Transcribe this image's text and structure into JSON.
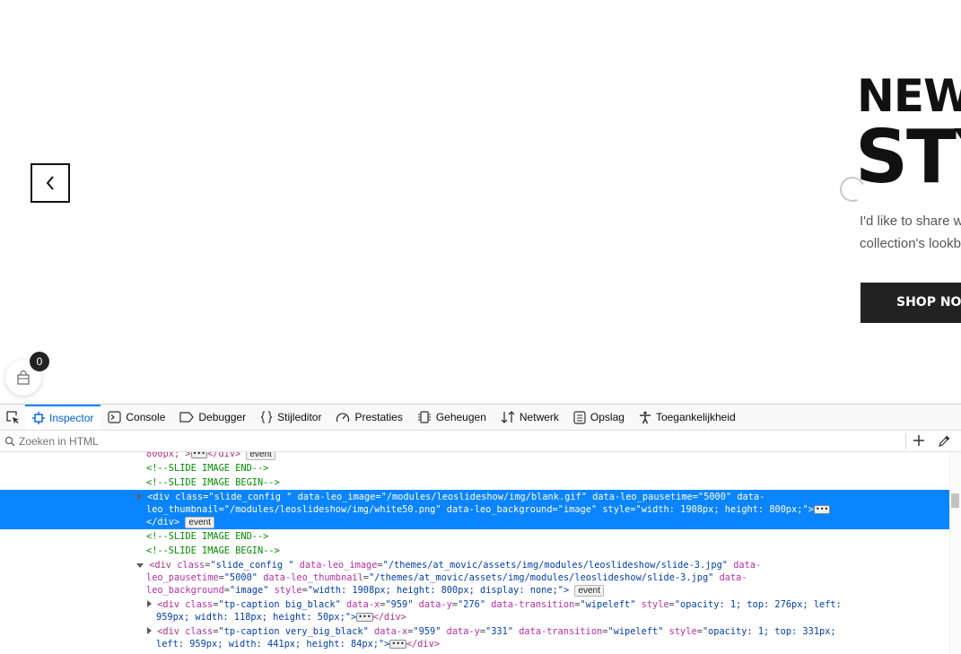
{
  "page": {
    "hero": {
      "line1": "NEW",
      "line2": "STY",
      "desc_line1": "I'd like to share w",
      "desc_line2": "collection's lookb",
      "button_label": "SHOP NOW"
    },
    "cart": {
      "count": "0"
    }
  },
  "devtools": {
    "tabs": [
      {
        "label": "Inspector",
        "icon": "inspector-icon"
      },
      {
        "label": "Console",
        "icon": "console-icon"
      },
      {
        "label": "Debugger",
        "icon": "debugger-icon"
      },
      {
        "label": "Stijleditor",
        "icon": "style-editor-icon"
      },
      {
        "label": "Prestaties",
        "icon": "performance-icon"
      },
      {
        "label": "Geheugen",
        "icon": "memory-icon"
      },
      {
        "label": "Netwerk",
        "icon": "network-icon"
      },
      {
        "label": "Opslag",
        "icon": "storage-icon"
      },
      {
        "label": "Toegankelijkheid",
        "icon": "accessibility-icon"
      }
    ],
    "active_tab": "Inspector",
    "search": {
      "placeholder": "Zoeken in HTML",
      "value": ""
    },
    "markup": {
      "l0_text": "800px;\">",
      "l0_close": "</div>",
      "event": "event",
      "comment_end": "<!--SLIDE IMAGE END-->",
      "comment_begin": "<!--SLIDE IMAGE BEGIN-->",
      "sel_l1": "<div class=\"slide_config \" data-leo_image=\"/modules/leoslideshow/img/blank.gif\" data-leo_pausetime=\"5000\" data-",
      "sel_l2": "leo_thumbnail=\"/modules/leoslideshow/img/white50.png\" data-leo_background=\"image\" style=\"width: 1908px; height: 800px;\">",
      "sel_l3": "</div>",
      "exp_l1_tag": "<div",
      "exp_l1_attrs": [
        {
          "name": "class",
          "value": "\"slide_config \""
        },
        {
          "name": "data-leo_image",
          "value": "\"/themes/at_movic/assets/img/modules/leoslideshow/slide-3.jpg\""
        }
      ],
      "exp_l1_tail": "data-",
      "exp_l2_head": "leo_pausetime",
      "exp_l2_head_val": "\"5000\"",
      "exp_l2_attr": "data-leo_thumbnail",
      "exp_l2_attr_val": "\"/themes/at_movic/assets/img/modules/leoslideshow/slide-3.jpg\"",
      "exp_l2_tail": "data-",
      "exp_l3_head": "leo_background",
      "exp_l3_head_val": "\"image\"",
      "exp_l3_style": "style",
      "exp_l3_style_val": "\"width: 1908px; height: 800px; display: none;\">",
      "c1_l1_tag": "<div",
      "c1_l1_class": "class",
      "c1_l1_class_val": "\"tp-caption big_black\"",
      "c1_l1_x": "data-x",
      "c1_l1_x_val": "\"959\"",
      "c1_l1_y": "data-y",
      "c1_l1_y_val": "\"276\"",
      "c1_l1_tr": "data-transition",
      "c1_l1_tr_val": "\"wipeleft\"",
      "c1_l1_style": "style",
      "c1_l1_style_val": "\"opacity: 1; top: 276px; left:",
      "c1_l2": "959px; width: 118px; height: 50px;\">",
      "c1_l2_close": "</div>",
      "c2_l1_tag": "<div",
      "c2_l1_class": "class",
      "c2_l1_class_val": "\"tp-caption very_big_black\"",
      "c2_l1_x": "data-x",
      "c2_l1_x_val": "\"959\"",
      "c2_l1_y": "data-y",
      "c2_l1_y_val": "\"331\"",
      "c2_l1_tr": "data-transition",
      "c2_l1_tr_val": "\"wipeleft\"",
      "c2_l1_style": "style",
      "c2_l1_style_val": "\"opacity: 1; top: 331px;",
      "c2_l2": "left: 959px; width: 441px; height: 84px;\">",
      "c2_l2_close": "</div>"
    }
  },
  "colors": {
    "selection": "#0a84ff",
    "active_tab": "#0060df",
    "comment": "#058b00"
  }
}
